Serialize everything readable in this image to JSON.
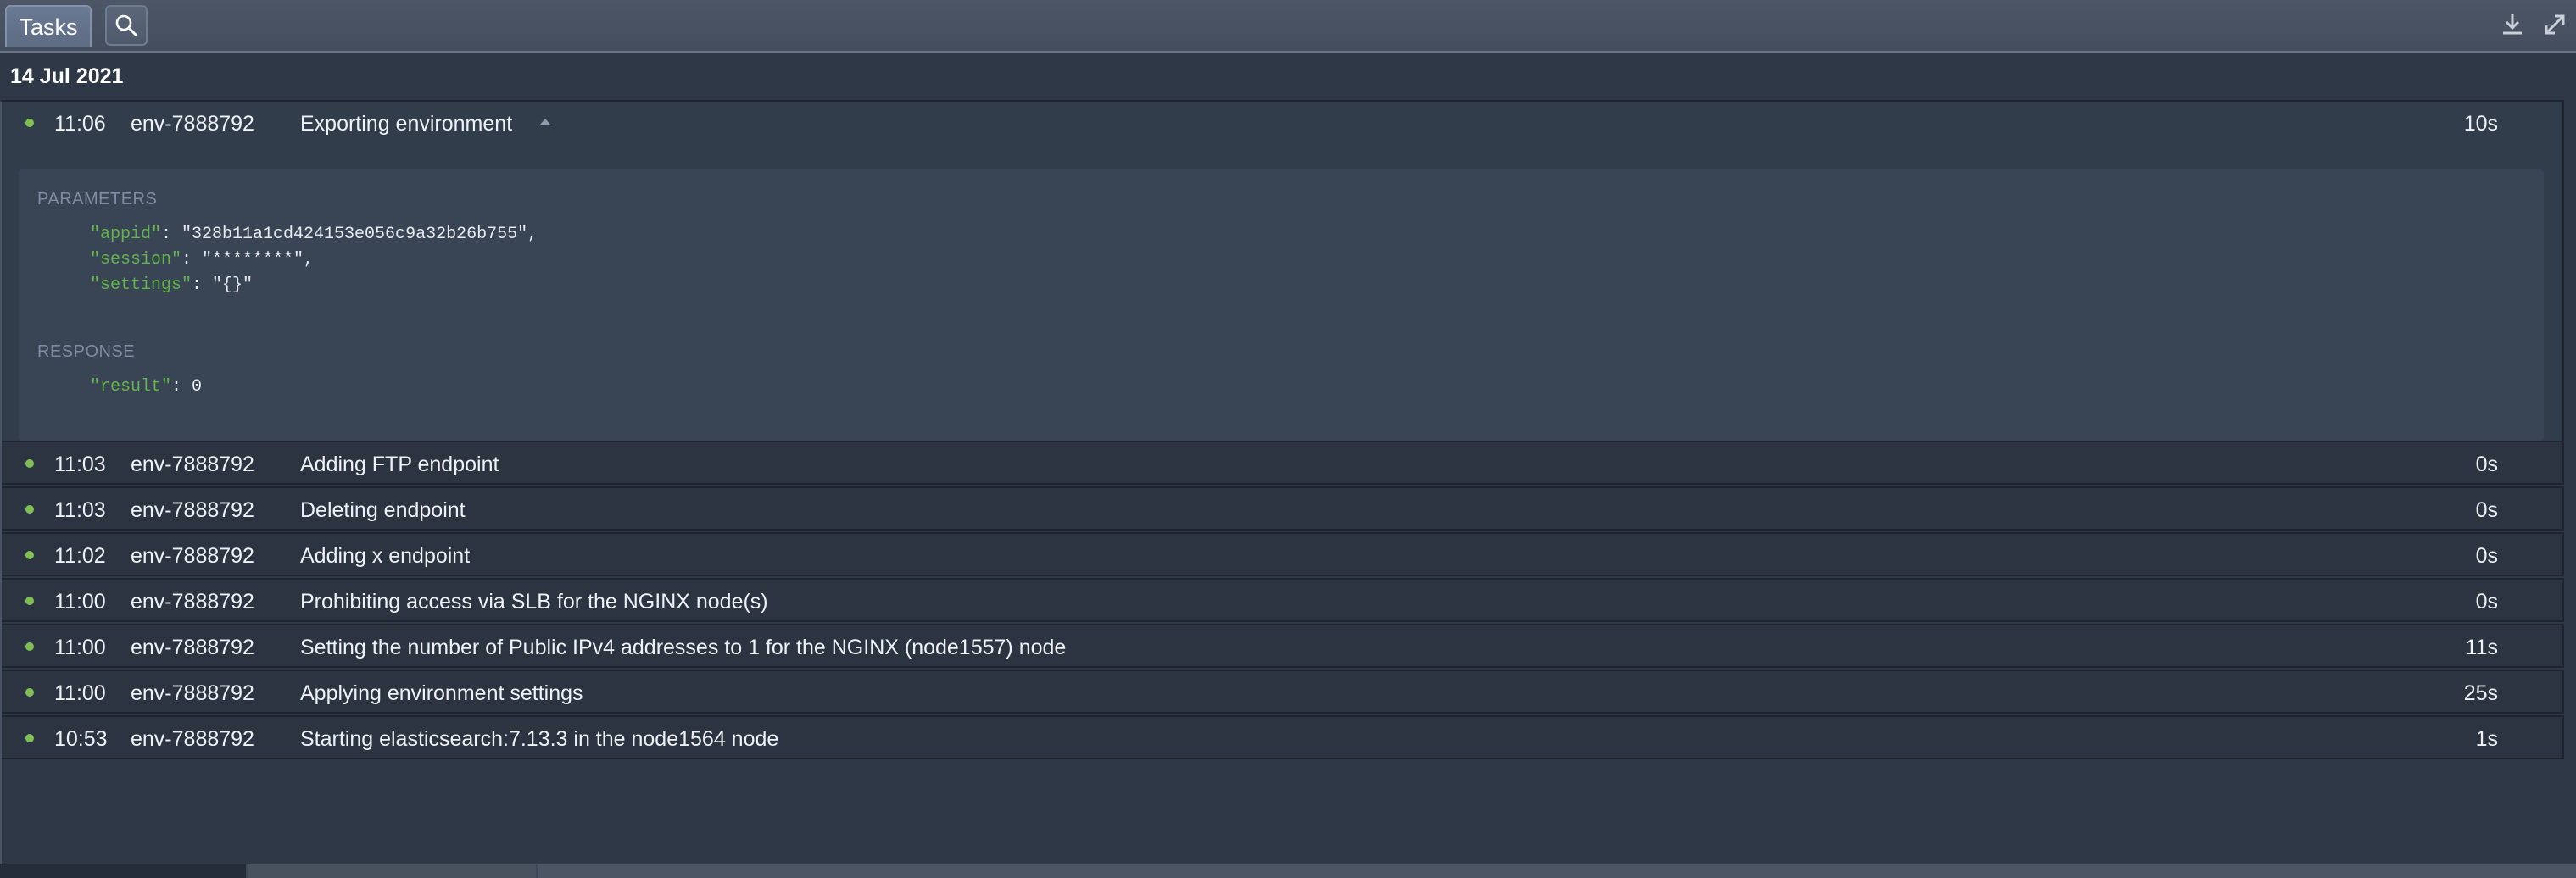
{
  "toolbar": {
    "tab_label": "Tasks",
    "search_icon": "search-icon",
    "download_icon": "download-icon",
    "expand_icon": "expand-icon"
  },
  "date_header": "14 Jul 2021",
  "expanded_task": {
    "time": "11:06",
    "env": "env-7888792",
    "description": "Exporting environment",
    "duration": "10s",
    "parameters_label": "PARAMETERS",
    "parameters": [
      {
        "key": "\"appid\"",
        "value": ": \"328b11a1cd424153e056c9a32b26b755\","
      },
      {
        "key": "\"session\"",
        "value": ": \"********\","
      },
      {
        "key": "\"settings\"",
        "value": ": \"{}\""
      }
    ],
    "response_label": "RESPONSE",
    "response": [
      {
        "key": "\"result\"",
        "value": ": 0"
      }
    ]
  },
  "tasks": [
    {
      "time": "11:03",
      "env": "env-7888792",
      "description": "Adding FTP endpoint",
      "duration": "0s"
    },
    {
      "time": "11:03",
      "env": "env-7888792",
      "description": "Deleting endpoint",
      "duration": "0s"
    },
    {
      "time": "11:02",
      "env": "env-7888792",
      "description": "Adding x endpoint",
      "duration": "0s"
    },
    {
      "time": "11:00",
      "env": "env-7888792",
      "description": "Prohibiting access via SLB for the NGINX node(s)",
      "duration": "0s"
    },
    {
      "time": "11:00",
      "env": "env-7888792",
      "description": "Setting the number of Public IPv4 addresses to 1 for the NGINX (node1557) node",
      "duration": "11s"
    },
    {
      "time": "11:00",
      "env": "env-7888792",
      "description": "Applying environment settings",
      "duration": "25s"
    },
    {
      "time": "10:53",
      "env": "env-7888792",
      "description": "Starting elasticsearch:7.13.3 in the node1564 node",
      "duration": "1s"
    }
  ],
  "colors": {
    "status_dot": "#7fbf52",
    "json_key": "#63b54a"
  }
}
